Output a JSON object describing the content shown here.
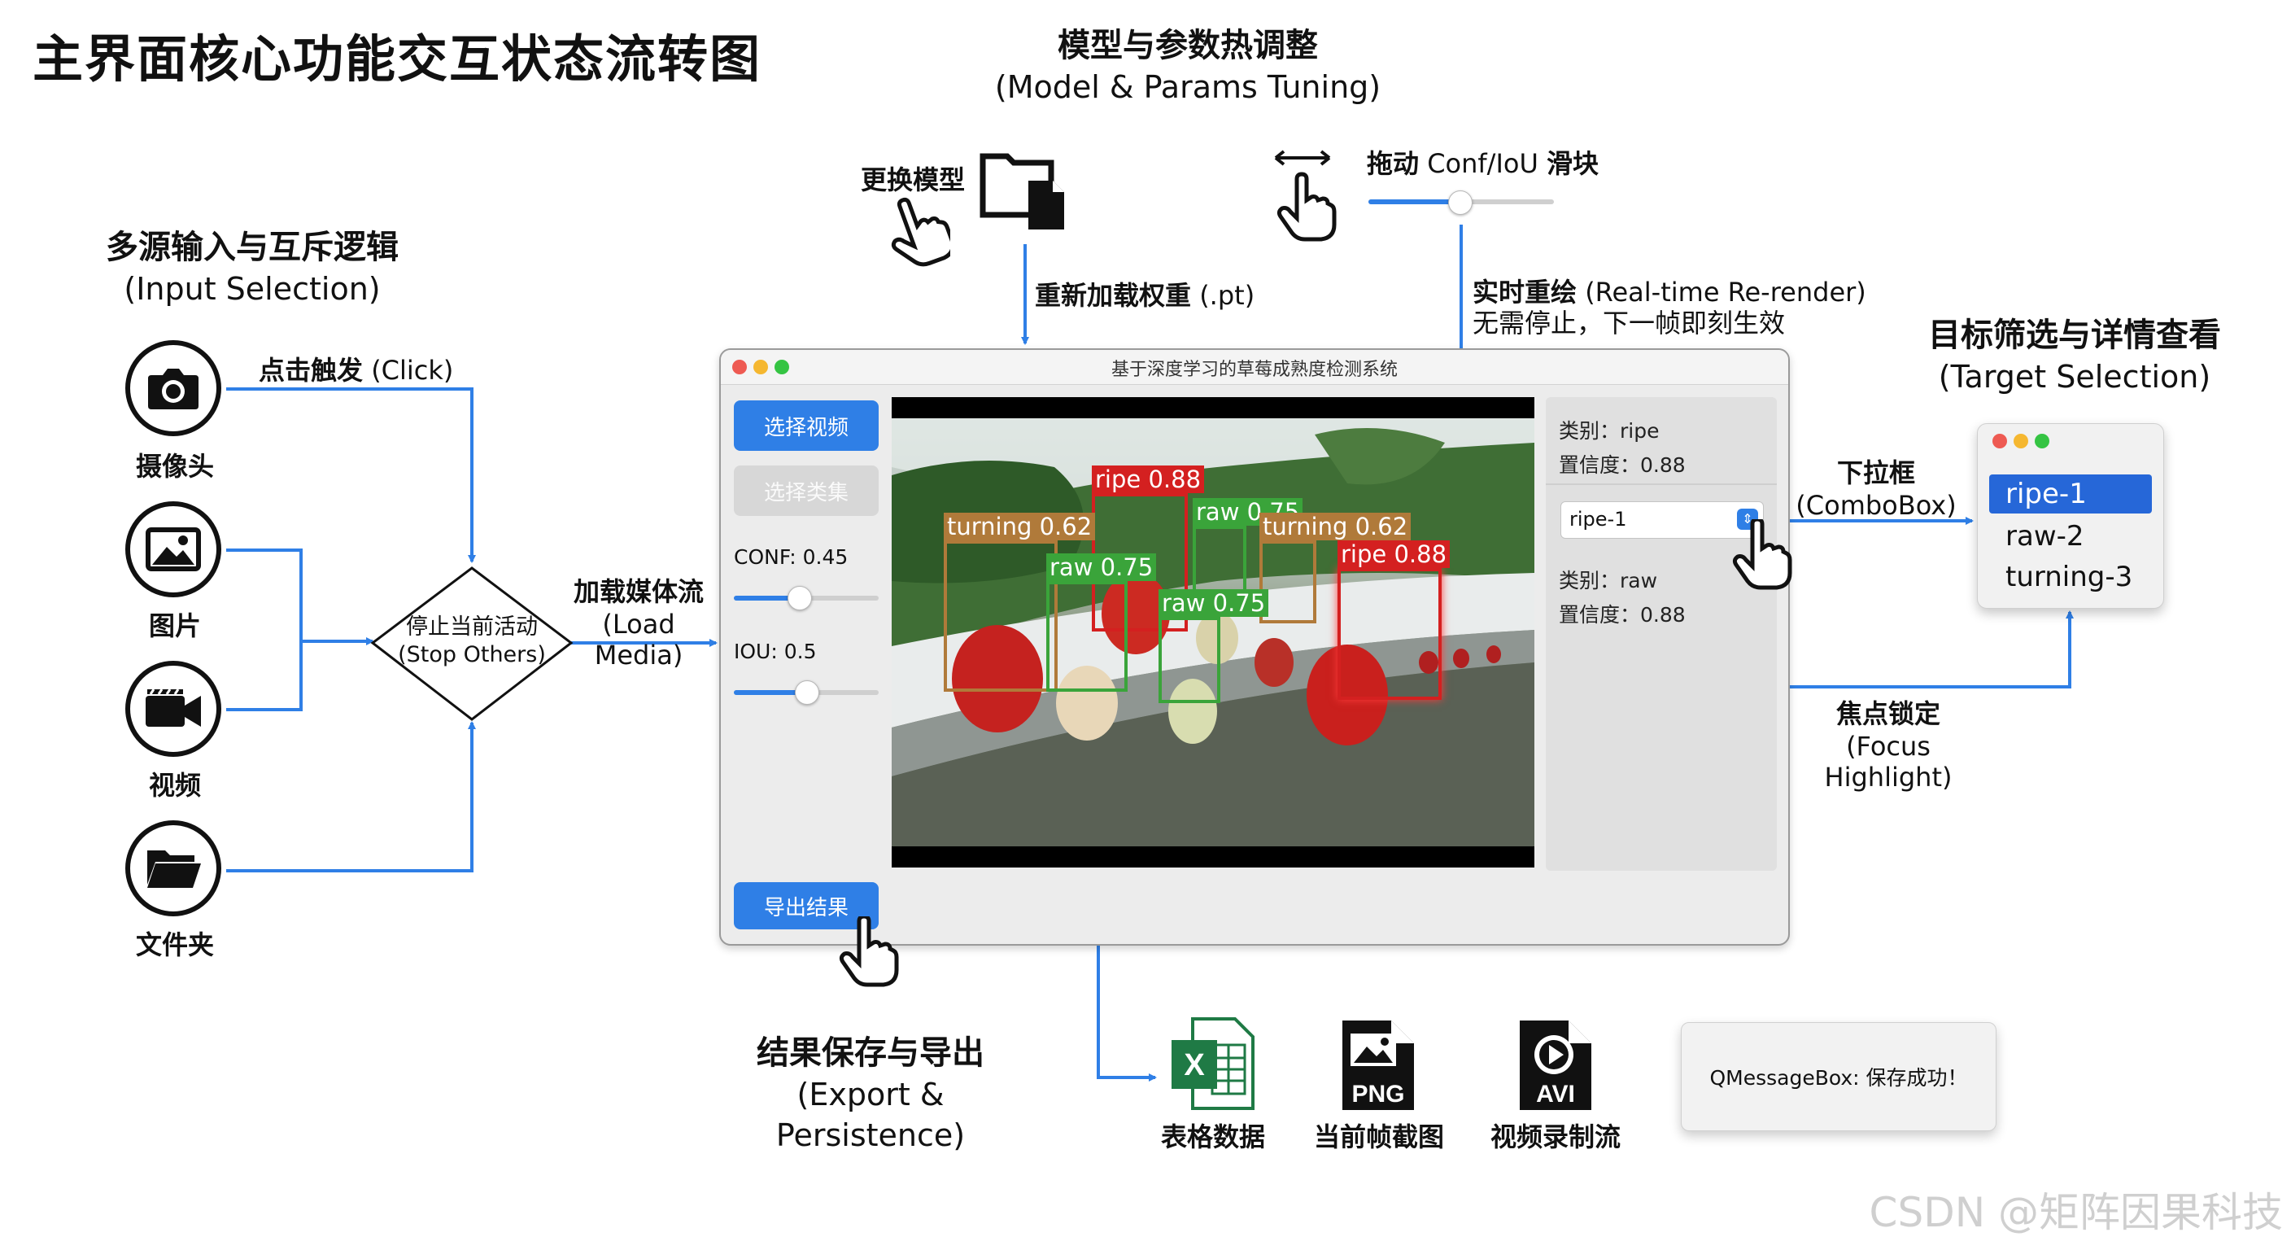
{
  "title": "主界面核心功能交互状态流转图",
  "sections": {
    "model": {
      "title": "模型与参数热调整",
      "subtitle": "(Model & Params Tuning)"
    },
    "input": {
      "title": "多源输入与互斥逻辑",
      "subtitle": "(Input Selection)"
    },
    "target": {
      "title": "目标筛选与详情查看",
      "subtitle": "(Target Selection)"
    },
    "export": {
      "title": "结果保存与导出",
      "subtitle": "(Export & Persistence)"
    }
  },
  "annotations": {
    "change_model": "更换模型",
    "reload_weights_cn": "重新加载权重",
    "reload_weights_en": "(.pt)",
    "drag_cn": "拖动",
    "drag_mid": "Conf/IoU",
    "drag_end": "滑块",
    "rerender_cn": "实时重绘",
    "rerender_en": "(Real-time Re-render)",
    "rerender_note": "无需停止，下一帧即刻生效",
    "click_cn": "点击触发",
    "click_en": "(Click)",
    "load_cn": "加载媒体流",
    "load_en": "(Load Media)",
    "dropdown_cn": "下拉框",
    "dropdown_en": "(ComboBox)",
    "focus_cn": "焦点锁定",
    "focus_en": "(Focus Highlight)"
  },
  "sources": [
    {
      "label": "摄像头",
      "icon": "camera-icon"
    },
    {
      "label": "图片",
      "icon": "image-icon"
    },
    {
      "label": "视频",
      "icon": "video-icon"
    },
    {
      "label": "文件夹",
      "icon": "folder-icon"
    }
  ],
  "decision": {
    "line1": "停止当前活动",
    "line2": "(Stop Others)"
  },
  "app": {
    "window_title": "基于深度学习的草莓成熟度检测系统",
    "btn_select_video": "选择视频",
    "btn_select_folder": "选择类集",
    "conf_label": "CONF: 0.45",
    "conf_value": 0.45,
    "iou_label": "IOU: 0.5",
    "iou_value": 0.5,
    "btn_export": "导出结果",
    "detail1": {
      "class": "类别：ripe",
      "conf": "置信度：0.88"
    },
    "combo_value": "ripe-1",
    "detail2": {
      "class": "类别：raw",
      "conf": "置信度：0.88"
    },
    "detections": [
      {
        "label": "ripe 0.88",
        "color": "#d42020"
      },
      {
        "label": "raw 0.75",
        "color": "#3aa43a"
      },
      {
        "label": "turning 0.62",
        "color": "#b07a3a"
      },
      {
        "label": "raw 0.75",
        "color": "#3aa43a"
      },
      {
        "label": "turning 0.62",
        "color": "#b07a3a"
      },
      {
        "label": "raw 0.75",
        "color": "#3aa43a"
      },
      {
        "label": "ripe 0.88",
        "color": "#d42020"
      }
    ]
  },
  "dropdown_items": [
    "ripe-1",
    "raw-2",
    "turning-3"
  ],
  "exports": [
    {
      "label": "表格数据",
      "badge": "X",
      "icon": "excel-file-icon"
    },
    {
      "label": "当前帧截图",
      "badge": "PNG",
      "icon": "png-file-icon"
    },
    {
      "label": "视频录制流",
      "badge": "AVI",
      "icon": "avi-file-icon"
    }
  ],
  "message_box": "QMessageBox: 保存成功！",
  "watermark": "CSDN @矩阵因果科技",
  "colors": {
    "accent": "#2f7fe6",
    "line": "#2f7fe6"
  }
}
